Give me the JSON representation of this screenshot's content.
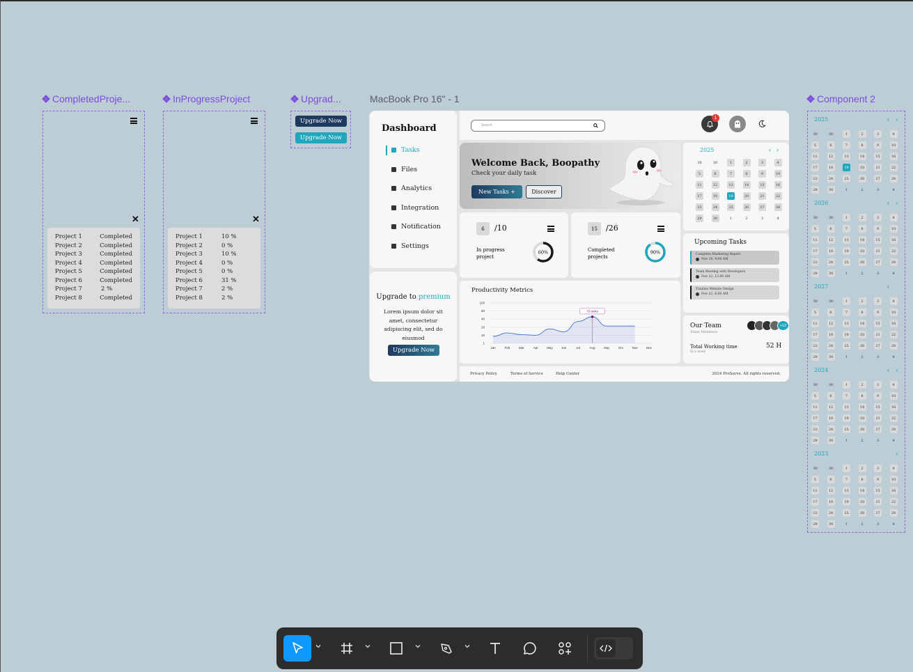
{
  "frames": {
    "completed": "CompletedProje...",
    "inprogress": "InProgressProject",
    "upgrade": "Upgrad...",
    "macbook": "MacBook Pro 16\" - 1",
    "component2": "Component 2"
  },
  "completed_projects": [
    {
      "name": "Project 1",
      "status": "Completed"
    },
    {
      "name": "Project 2",
      "status": "Completed"
    },
    {
      "name": "Project 3",
      "status": "Completed"
    },
    {
      "name": "Project 4",
      "status": "Completed"
    },
    {
      "name": "Project 5",
      "status": "Completed"
    },
    {
      "name": "Project 6",
      "status": "Completed"
    },
    {
      "name": "Project 7",
      "status": "2 %"
    },
    {
      "name": "Project 8",
      "status": "Completed"
    }
  ],
  "inprogress_projects": [
    {
      "name": "Project 1",
      "status": "10 %"
    },
    {
      "name": "Project 2",
      "status": "0 %"
    },
    {
      "name": "Project 3",
      "status": "10 %"
    },
    {
      "name": "Project 4",
      "status": "0 %"
    },
    {
      "name": "Project 5",
      "status": "0 %"
    },
    {
      "name": "Project 6",
      "status": "31 %"
    },
    {
      "name": "Project 7",
      "status": "2 %"
    },
    {
      "name": "Project 8",
      "status": "2 %"
    }
  ],
  "upgrade_variants": [
    "Upgrade Now",
    "Upgrade Now"
  ],
  "dashboard": {
    "title": "Dashboard",
    "nav": [
      {
        "label": "Tasks",
        "icon": "clipboard-icon",
        "active": true
      },
      {
        "label": "Files",
        "icon": "files-icon"
      },
      {
        "label": "Analytics",
        "icon": "document-icon"
      },
      {
        "label": "Integration",
        "icon": "integration-icon"
      },
      {
        "label": "Notification",
        "icon": "bell-icon"
      },
      {
        "label": "Settings",
        "icon": "gear-icon"
      }
    ],
    "upgrade": {
      "title_pre": "Upgrade to ",
      "title_accent": "premium",
      "body": "Lorem ipsum dolor sit amet, consectetur adipiscing elit, sed do eiusmod",
      "button": "Upgrade Now"
    },
    "search_placeholder": "Search",
    "notification_count": "1",
    "welcome": {
      "title": "Welcome Back, Boopathy",
      "subtitle": "Check your daily task",
      "new_task": "New Tasks +",
      "discover": "Discover"
    },
    "stats": [
      {
        "count": "6",
        "total": "/10",
        "label1": "In progress",
        "label2": "project",
        "percent": "60%",
        "value": 60
      },
      {
        "count": "15",
        "total": "/26",
        "label1": "Completed",
        "label2": "projects",
        "percent": "90%",
        "value": 90
      }
    ],
    "calendar": {
      "year": "2025",
      "rows": [
        [
          "30",
          "30",
          "1",
          "2",
          "3",
          "4"
        ],
        [
          "5",
          "6",
          "7",
          "8",
          "9",
          "10"
        ],
        [
          "11",
          "12",
          "13",
          "14",
          "15",
          "16"
        ],
        [
          "17",
          "18",
          "19",
          "20",
          "21",
          "22"
        ],
        [
          "23",
          "24",
          "25",
          "26",
          "27",
          "28"
        ],
        [
          "29",
          "30",
          "1",
          "2",
          "3",
          "4"
        ]
      ],
      "selected": "19"
    },
    "upcoming": {
      "title": "Upcoming Tasks",
      "items": [
        {
          "title": "Complete Marketing Report",
          "time": "Nov 20, 9:00 AM"
        },
        {
          "title": "Team Meeting with Developers",
          "time": "Nov 22, 12:00 AM"
        },
        {
          "title": "Finalize Website Design",
          "time": "Nov 22, 6:00 AM"
        }
      ]
    },
    "team": {
      "title": "Our Team",
      "subtitle": "Team Members",
      "extra": "+12",
      "working_label": "Total Working time",
      "working_sub": "In a week",
      "working_value": "52 H"
    },
    "footer": {
      "links": [
        "Privacy Policy",
        "Terms of Service",
        "Help Center"
      ],
      "copyright": "2024 ProServe. All rights reserved."
    }
  },
  "chart_data": {
    "type": "area",
    "title": "Productivity Metrics",
    "categories": [
      "Jan",
      "Feb",
      "Mar",
      "Apr",
      "May",
      "Jun",
      "Jul",
      "Aug",
      "Sep",
      "Oct",
      "Nov",
      "Dec"
    ],
    "series": [
      {
        "values": [
          12,
          18,
          15,
          14,
          25,
          20,
          38,
          46,
          30,
          30,
          30,
          null
        ]
      }
    ],
    "yticks": [
      "100",
      "60",
      "40",
      "20",
      "10",
      "1"
    ],
    "ylim": [
      0,
      100
    ],
    "annotation": {
      "label": "75 tasks",
      "category": "Aug"
    },
    "grid": true
  },
  "component2": [
    {
      "year": "2025",
      "arrows": "both",
      "selected": "19"
    },
    {
      "year": "2026",
      "arrows": "both",
      "selected": ""
    },
    {
      "year": "2027",
      "arrows": "left",
      "selected": ""
    },
    {
      "year": "2024",
      "arrows": "both",
      "selected": ""
    },
    {
      "year": "2023",
      "arrows": "right",
      "selected": ""
    }
  ],
  "toolbar": {
    "tools": [
      "move-tool",
      "frame-tool",
      "rectangle-tool",
      "pen-tool",
      "text-tool",
      "comment-tool",
      "actions-tool",
      "dev-mode-toggle"
    ]
  },
  "colors": {
    "accent": "#20a7bd",
    "navy": "#1f3a5f",
    "canvas": "#bccdd6",
    "purple": "#7c4ddb"
  }
}
